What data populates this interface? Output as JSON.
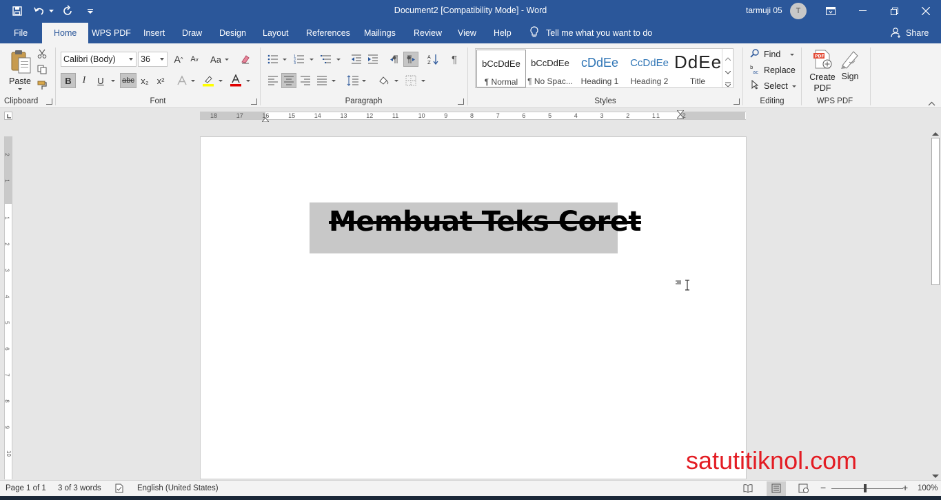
{
  "titlebar": {
    "title": "Document2 [Compatibility Mode]  -  Word",
    "user_name": "tarmuji 05",
    "avatar_initial": "T"
  },
  "tabs": [
    "File",
    "Home",
    "WPS PDF",
    "Insert",
    "Draw",
    "Design",
    "Layout",
    "References",
    "Mailings",
    "Review",
    "View",
    "Help"
  ],
  "active_tab": "Home",
  "tell_me": "Tell me what you want to do",
  "share_label": "Share",
  "clipboard": {
    "paste_label": "Paste",
    "group_label": "Clipboard"
  },
  "font": {
    "family": "Calibri (Body)",
    "size": "36",
    "group_label": "Font",
    "bold": "B",
    "italic": "I",
    "underline": "U",
    "strike": "abc",
    "sub": "x₂",
    "sup": "x²",
    "grow": "A",
    "shrink": "A",
    "case": "Aa"
  },
  "paragraph": {
    "group_label": "Paragraph"
  },
  "styles": {
    "group_label": "Styles",
    "items": [
      {
        "preview": "bCcDdEe",
        "name": "¶ Normal"
      },
      {
        "preview": "bCcDdEe",
        "name": "¶ No Spac..."
      },
      {
        "preview": "cDdEe",
        "name": "Heading 1"
      },
      {
        "preview": "CcDdEe",
        "name": "Heading 2"
      },
      {
        "preview": "DdEe",
        "name": "Title"
      }
    ]
  },
  "editing": {
    "find": "Find",
    "replace": "Replace",
    "select": "Select",
    "group_label": "Editing"
  },
  "wps_pdf": {
    "create_line1": "Create",
    "create_line2": "PDF",
    "sign": "Sign",
    "group_label": "WPS PDF"
  },
  "ruler": {
    "numbers": [
      "18",
      "17",
      "16",
      "15",
      "14",
      "13",
      "12",
      "11",
      "10",
      "9",
      "8",
      "7",
      "6",
      "5",
      "4",
      "3",
      "2",
      "1",
      "1",
      "2"
    ]
  },
  "vruler": {
    "numbers": [
      "2",
      "1",
      "1",
      "2",
      "3",
      "4",
      "5",
      "6",
      "7",
      "8",
      "9",
      "10"
    ]
  },
  "document": {
    "heading_text": "Membuat Teks Coret"
  },
  "watermark": "satutitiknol.com",
  "status": {
    "page": "Page 1 of 1",
    "words": "3 of 3 words",
    "language": "English (United States)",
    "zoom": "100%"
  }
}
